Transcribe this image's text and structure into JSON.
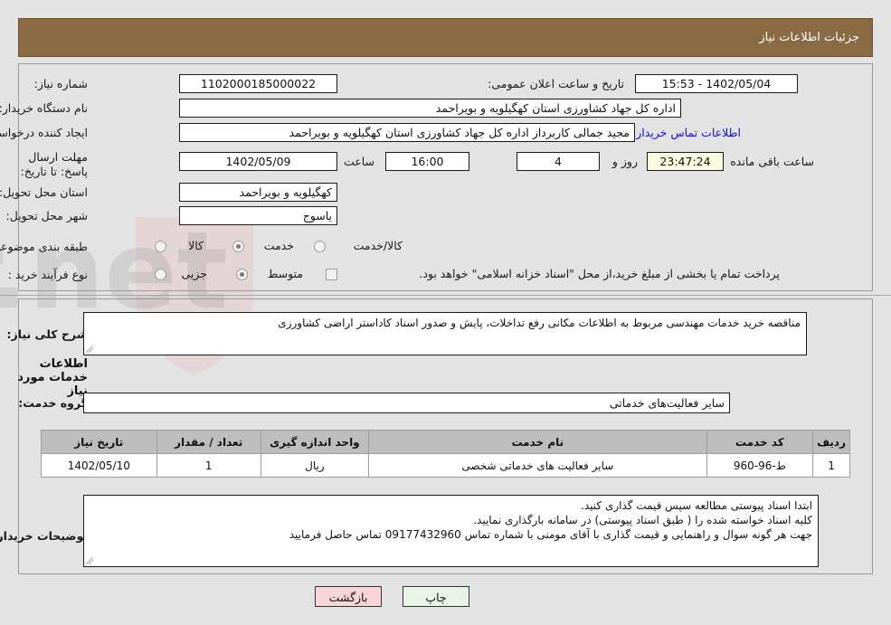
{
  "header": {
    "title": "جزئیات اطلاعات نیاز"
  },
  "fields": {
    "need_number_label": "شماره نیاز:",
    "need_number_value": "1102000185000022",
    "announce_label": "تاریخ و ساعت اعلان عمومی:",
    "announce_value": "1402/05/04 - 15:53",
    "buyer_org_label": "نام دستگاه خریدار:",
    "buyer_org_value": "اداره کل جهاد کشاورزی استان کهگیلویه و بویراحمد",
    "creator_label": "ایجاد کننده درخواست:",
    "creator_value": "مجید جمالی کاربرداز اداره کل جهاد کشاورزی استان کهگیلویه و بویراحمد",
    "contact_link": "اطلاعات تماس خریدار",
    "deadline_label": "مهلت ارسال پاسخ: تا تاریخ:",
    "deadline_date": "1402/05/09",
    "time_label": "ساعت",
    "deadline_time": "16:00",
    "days_remaining": "4",
    "days_word": "روز و",
    "countdown": "23:47:24",
    "remaining_word": "ساعت باقی مانده",
    "province_label": "استان محل تحویل:",
    "province_value": "کهگیلویه و بویراحمد",
    "city_label": "شهر محل تحویل:",
    "city_value": "یاسوج",
    "category_label": "طبقه بندی موضوعی:",
    "process_label": "نوع فرآیند خرید :",
    "payment_note": "پرداخت تمام یا بخشی از مبلغ خرید،از محل \"اسناد خزانه اسلامی\" خواهد بود."
  },
  "category_options": [
    {
      "label": "کالا",
      "selected": false
    },
    {
      "label": "خدمت",
      "selected": true
    },
    {
      "label": "کالا/خدمت",
      "selected": false
    }
  ],
  "process_options": [
    {
      "label": "جزیی",
      "selected": false
    },
    {
      "label": "متوسط",
      "selected": true
    }
  ],
  "summary": {
    "label": "شرح کلی نیاز:",
    "value": "مناقصه خرید خدمات مهندسی مربوط به اطلاعات مکانی رفع تداخلات، پایش و صدور اسناد کاداستر اراضی کشاورزی"
  },
  "services_section": {
    "heading": "اطلاعات خدمات مورد نیاز",
    "group_label": "گروه خدمت:",
    "group_value": "سایر فعالیت‌های خدماتی"
  },
  "table": {
    "columns": [
      "ردیف",
      "کد خدمت",
      "نام خدمت",
      "واحد اندازه گیری",
      "تعداد / مقدار",
      "تاریخ نیاز"
    ],
    "rows": [
      {
        "row": "1",
        "code": "ط-96-960",
        "name": "سایر فعالیت های خدماتی شخصی",
        "unit": "ریال",
        "qty": "1",
        "date": "1402/05/10"
      }
    ]
  },
  "buyer_notes": {
    "label": "توضیحات خریدار:",
    "lines": [
      "ابتدا اسناد پیوستی مطالعه سپس قیمت گذاری کنید.",
      "کلیه اسناد خواسته شده را ( طبق اسناد پیوستی) در سامانه بارگذاری نمایید.",
      "جهت هر گونه سوال و راهنمایی و قیمت گذاری با آقای مومنی با شماره تماس 09177432960 تماس حاصل فرمایید"
    ]
  },
  "buttons": {
    "print": "چاپ",
    "back": "بازگشت"
  },
  "watermark": {
    "text": "ArtaTender.net"
  },
  "colors": {
    "header_bg": "#8a6a42",
    "link": "#1111dd",
    "print_btn": "#e6f5e6",
    "back_btn": "#fad5d5",
    "page_bg": "#e3e3e3"
  }
}
